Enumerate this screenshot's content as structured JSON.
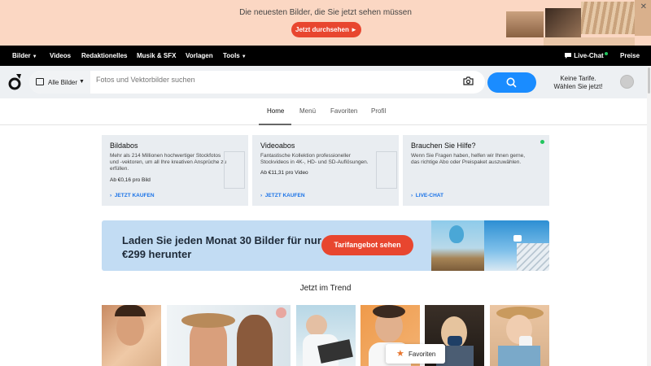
{
  "promo": {
    "text": "Die neuesten Bilder, die Sie jetzt sehen müssen",
    "button": "Jetzt durchsehen ►",
    "close": "✕"
  },
  "nav": {
    "items": [
      "Bilder",
      "Videos",
      "Redaktionelles",
      "Musik & SFX",
      "Vorlagen",
      "Tools"
    ],
    "live_chat": "Live-Chat",
    "pricing": "Preise"
  },
  "search": {
    "type_label": "Alle Bilder",
    "placeholder": "Fotos und Vektorbilder suchen"
  },
  "account": {
    "line1": "Keine Tarife.",
    "line2": "Wählen Sie jetzt!"
  },
  "tabs": [
    "Home",
    "Menü",
    "Favoriten",
    "Profil"
  ],
  "cards": [
    {
      "title": "Bildabos",
      "desc": "Mehr als 214 Millionen hochwertiger Stockfotos und -vektoren, um all Ihre kreativen Ansprüche zu erfüllen.",
      "price": "Ab €0,16 pro Bild",
      "link": "JETZT KAUFEN"
    },
    {
      "title": "Videoabos",
      "desc": "Fantastische Kollektion professioneller Stockvideos in 4K-, HD- und SD-Auflösungen.",
      "price": "Ab €11,31 pro Video",
      "link": "JETZT KAUFEN"
    },
    {
      "title": "Brauchen Sie Hilfe?",
      "desc": "Wenn Sie Fragen haben, helfen wir Ihnen gerne, das richtige Abo oder Preispaket auszuwählen.",
      "price": "",
      "link": "LIVE-CHAT"
    }
  ],
  "ad": {
    "text": "Laden Sie jeden Monat 30 Bilder für nur €299 herunter",
    "button": "Tarifangebot sehen"
  },
  "trending": {
    "title": "Jetzt im Trend"
  },
  "favorites_button": "Favoriten",
  "colors": {
    "promo_bg": "#fbd7c3",
    "accent_red": "#e8462f",
    "search_blue": "#1a8cff",
    "link_blue": "#1a73e8",
    "online_green": "#22c55e"
  }
}
